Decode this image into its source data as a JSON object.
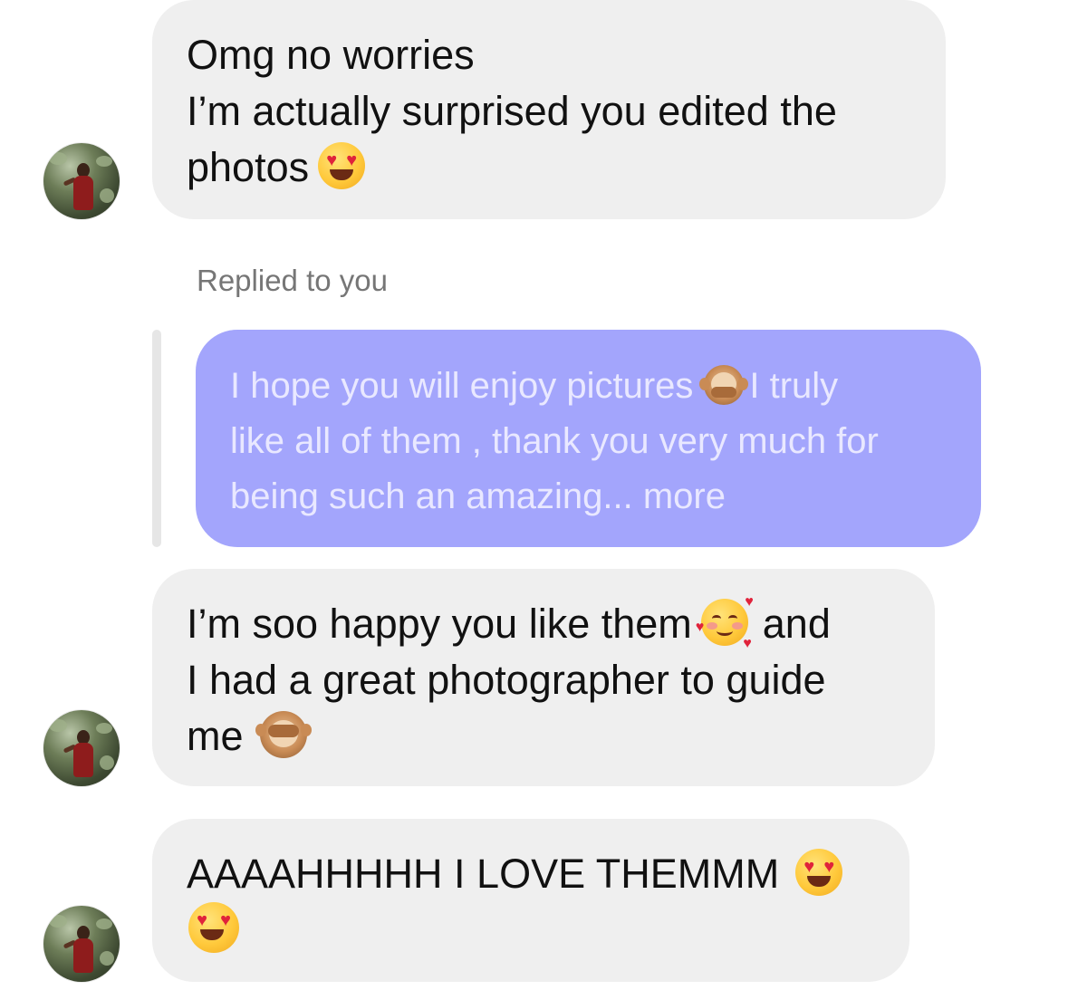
{
  "messages": [
    {
      "sender": "them",
      "lines": [
        "Omg no worries",
        "I’m actually surprised you edited the",
        "photos"
      ],
      "trailing_emoji": "heart-eyes"
    },
    {
      "sender": "them",
      "lines": [
        "I’m soo happy you like them",
        "and",
        "I had a great photographer to guide",
        "me"
      ]
    },
    {
      "sender": "them",
      "lines": [
        "AAAAHHHHH I LOVE THEMMM"
      ]
    }
  ],
  "reply": {
    "label": "Replied to you",
    "quoted_lines": [
      "I hope you will enjoy pictures",
      "I truly",
      "like all of them , thank you very much for",
      "being such an amazing... more"
    ]
  },
  "colors": {
    "incoming_bubble": "#efefef",
    "quoted_bubble": "#a3a5fc",
    "quoted_text": "#e9e8ff",
    "reply_label": "#767676"
  },
  "icons": [
    "heart-eyes-emoji",
    "speak-no-evil-monkey-emoji",
    "smiling-face-with-hearts-emoji",
    "see-no-evil-monkey-emoji",
    "avatar-photo"
  ]
}
